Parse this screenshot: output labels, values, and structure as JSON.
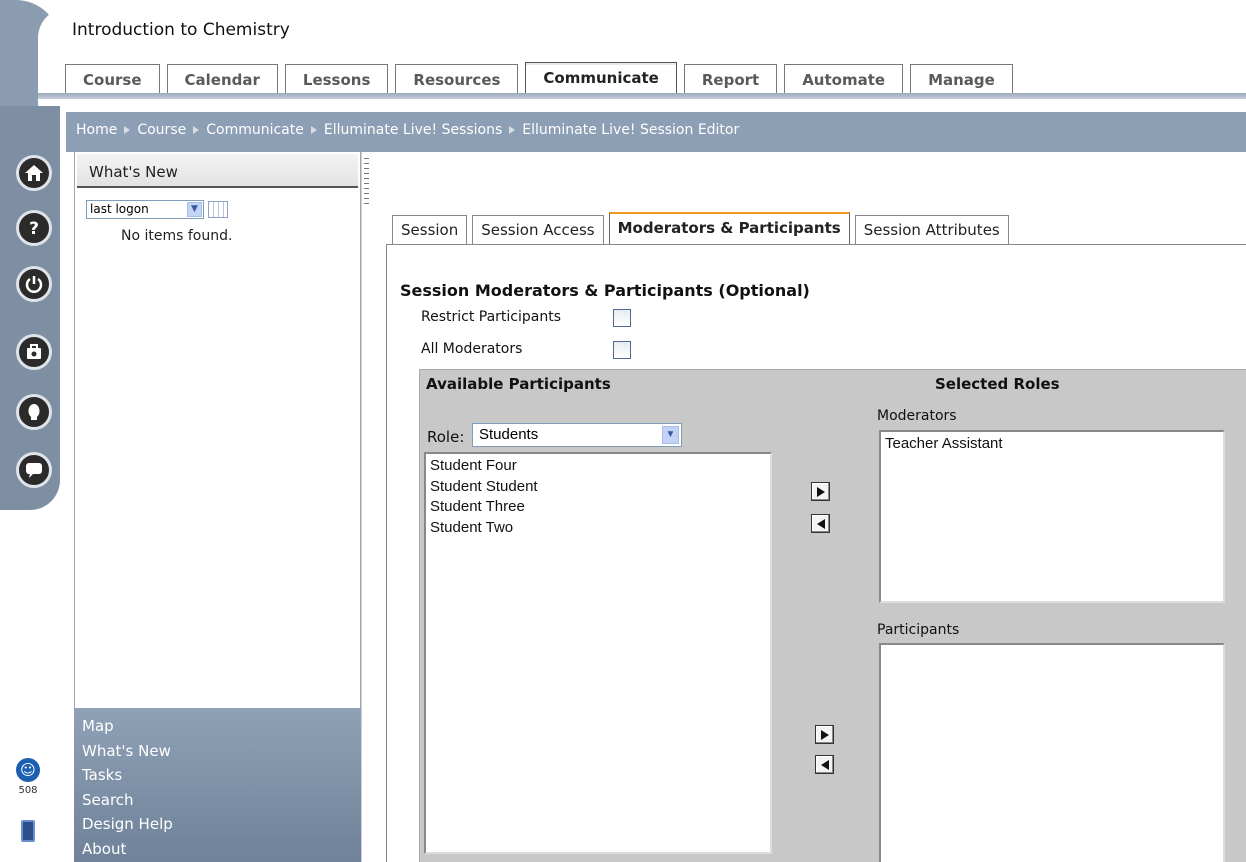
{
  "course": {
    "title": "Introduction to Chemistry"
  },
  "main_tabs": [
    {
      "label": "Course"
    },
    {
      "label": "Calendar"
    },
    {
      "label": "Lessons"
    },
    {
      "label": "Resources"
    },
    {
      "label": "Communicate",
      "active": true
    },
    {
      "label": "Report"
    },
    {
      "label": "Automate"
    },
    {
      "label": "Manage"
    }
  ],
  "breadcrumb": [
    "Home",
    "Course",
    "Communicate",
    "Elluminate Live! Sessions",
    "Elluminate Live! Session Editor"
  ],
  "rail": {
    "buttons": [
      "home-icon",
      "help-icon",
      "power-icon",
      "briefcase-icon",
      "person-icon",
      "chat-icon"
    ],
    "accessibility_label": "508",
    "pda_label": "PDA"
  },
  "whats_new": {
    "title": "What's New",
    "filter_value": "last logon",
    "empty_text": "No items found."
  },
  "left_links": [
    "Map",
    "What's New",
    "Tasks",
    "Search",
    "Design Help",
    "About"
  ],
  "sub_tabs": [
    {
      "label": "Session"
    },
    {
      "label": "Session Access"
    },
    {
      "label": "Moderators & Participants",
      "active": true
    },
    {
      "label": "Session Attributes"
    }
  ],
  "section": {
    "title": "Session Moderators & Participants (Optional)",
    "restrict_participants": {
      "label": "Restrict Participants",
      "checked": false
    },
    "all_moderators": {
      "label": "All Moderators",
      "checked": false
    }
  },
  "available": {
    "title": "Available Participants",
    "role_label": "Role:",
    "role_value": "Students",
    "items": [
      "Student Four",
      "Student Student",
      "Student Three",
      "Student Two"
    ]
  },
  "selected": {
    "title": "Selected Roles",
    "moderators_label": "Moderators",
    "moderators": [
      "Teacher Assistant"
    ],
    "participants_label": "Participants",
    "participants": []
  },
  "colors": {
    "rail_blue": "#7f8fa3",
    "crumb_band": "#8d9fb4",
    "active_tab_accent": "#ef9a1f",
    "panel_gray": "#c8c8c8"
  }
}
